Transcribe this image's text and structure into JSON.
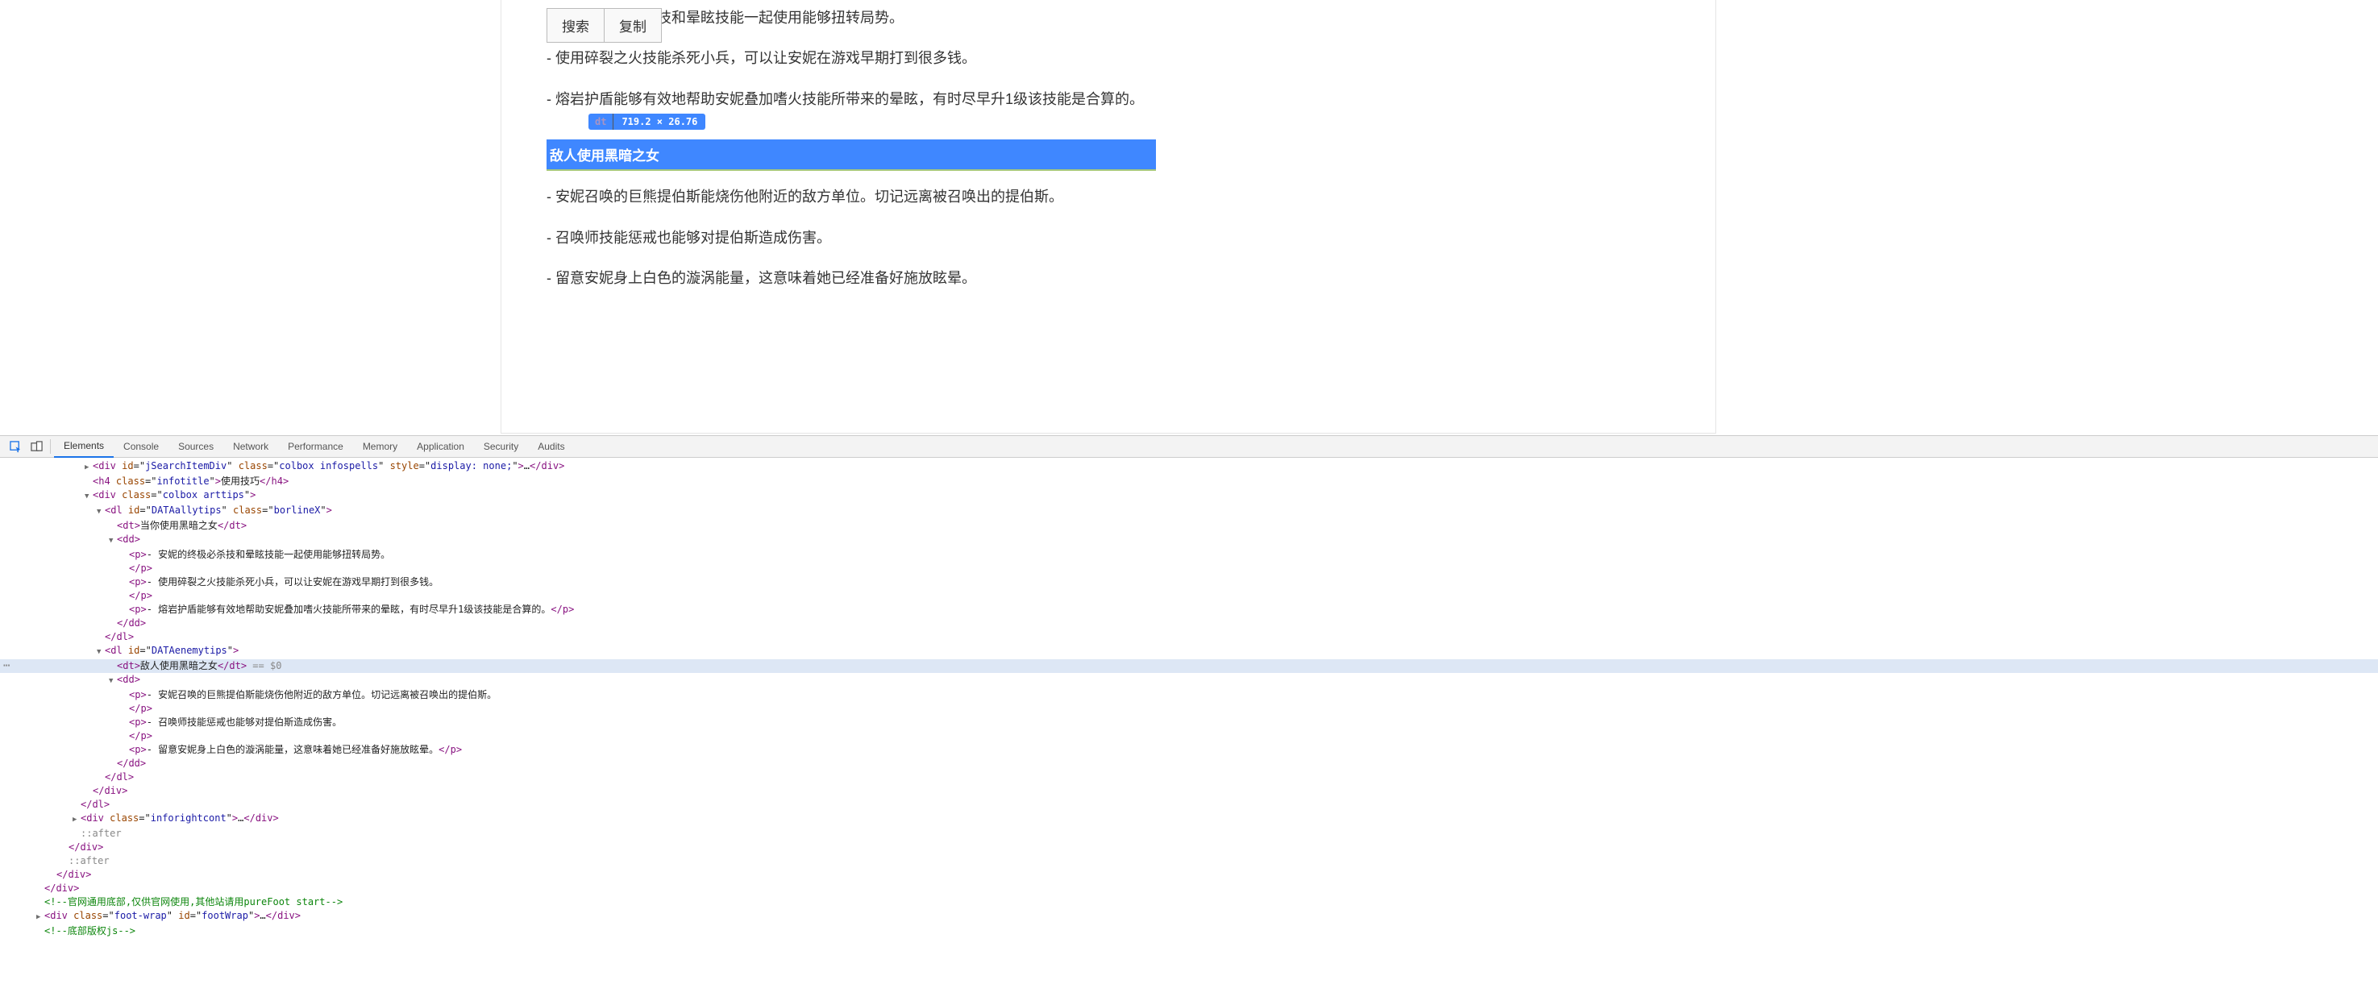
{
  "buttons": {
    "search": "搜索",
    "copy": "复制"
  },
  "inspect": {
    "tag": "dt",
    "dims": "719.2 × 26.76"
  },
  "ally_tips": {
    "tip1": "- 安妮的终极必杀技和晕眩技能一起使用能够扭转局势。",
    "tip2": "- 使用碎裂之火技能杀死小兵，可以让安妮在游戏早期打到很多钱。",
    "tip3": "- 熔岩护盾能够有效地帮助安妮叠加嗜火技能所带来的晕眩，有时尽早升1级该技能是合算的。"
  },
  "enemy_header": "敌人使用黑暗之女",
  "enemy_tips": {
    "tip1": "- 安妮召唤的巨熊提伯斯能烧伤他附近的敌方单位。切记远离被召唤出的提伯斯。",
    "tip2": "- 召唤师技能惩戒也能够对提伯斯造成伤害。",
    "tip3": "- 留意安妮身上白色的漩涡能量，这意味着她已经准备好施放眩晕。"
  },
  "devtools": {
    "tabs": {
      "elements": "Elements",
      "console": "Console",
      "sources": "Sources",
      "network": "Network",
      "performance": "Performance",
      "memory": "Memory",
      "application": "Application",
      "security": "Security",
      "audits": "Audits"
    }
  },
  "dom": {
    "l1": {
      "div_open": "div",
      "id_n": "id",
      "id_v": "jSearchItemDiv",
      "cls_n": "class",
      "cls_v": "colbox infospells",
      "sty_n": "style",
      "sty_v": "display: none;",
      "dots": "…",
      "div_close": "div"
    },
    "l2": {
      "tag": "h4",
      "cls_n": "class",
      "cls_v": "infotitle",
      "text": "使用技巧"
    },
    "l3": {
      "tag": "div",
      "cls_n": "class",
      "cls_v": "colbox arttips"
    },
    "l4": {
      "tag": "dl",
      "id_n": "id",
      "id_v": "DATAallytips",
      "cls_n": "class",
      "cls_v": "borlineX"
    },
    "l5": {
      "tag": "dt",
      "text": "当你使用黑暗之女"
    },
    "l6": {
      "tag": "dd"
    },
    "l7": {
      "tag": "p",
      "text": "- 安妮的终极必杀技和晕眩技能一起使用能够扭转局势。"
    },
    "l8": {
      "close": "p"
    },
    "l9": {
      "tag": "p",
      "text": "- 使用碎裂之火技能杀死小兵，可以让安妮在游戏早期打到很多钱。"
    },
    "l10": {
      "close": "p"
    },
    "l11": {
      "tag": "p",
      "text": "- 熔岩护盾能够有效地帮助安妮叠加嗜火技能所带来的晕眩，有时尽早升1级该技能是合算的。"
    },
    "l12": {
      "close": "p"
    },
    "l13": {
      "close": "dd"
    },
    "l14": {
      "close": "dl"
    },
    "l15": {
      "tag": "dl",
      "id_n": "id",
      "id_v": "DATAenemytips"
    },
    "l16": {
      "tag": "dt",
      "text": "敌人使用黑暗之女",
      "eq": " == $0"
    },
    "l17": {
      "tag": "dd"
    },
    "l18": {
      "tag": "p",
      "text": "- 安妮召唤的巨熊提伯斯能烧伤他附近的敌方单位。切记远离被召唤出的提伯斯。"
    },
    "l19": {
      "close": "p"
    },
    "l20": {
      "tag": "p",
      "text": "- 召唤师技能惩戒也能够对提伯斯造成伤害。"
    },
    "l21": {
      "close": "p"
    },
    "l22": {
      "tag": "p",
      "text": "- 留意安妮身上白色的漩涡能量，这意味着她已经准备好施放眩晕。"
    },
    "l23": {
      "close": "p"
    },
    "l24": {
      "close": "dd"
    },
    "l25": {
      "close": "dl"
    },
    "l26": {
      "close": "div"
    },
    "l27": {
      "close": "dl"
    },
    "l28": {
      "tag": "div",
      "cls_n": "class",
      "cls_v": "inforightcont",
      "dots": "…"
    },
    "l29": {
      "text": "::after"
    },
    "l30": {
      "close": "div"
    },
    "l31": {
      "text": "::after"
    },
    "l32": {
      "close": "div"
    },
    "l33": {
      "close": "div"
    },
    "l34": {
      "text": "官网通用底部,仅供官网使用,其他站请用pureFoot start"
    },
    "l35": {
      "tag": "div",
      "cls_n": "class",
      "cls_v": "foot-wrap",
      "id_n": "id",
      "id_v": "footWrap",
      "dots": "…"
    },
    "l36": {
      "text": "底部版权js"
    }
  }
}
